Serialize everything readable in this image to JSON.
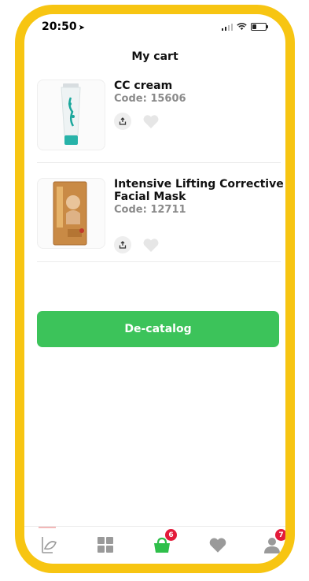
{
  "status_bar": {
    "time": "20:50"
  },
  "header": {
    "title": "My cart"
  },
  "cart": {
    "items": [
      {
        "name": "CC cream",
        "code": "Code: 15606"
      },
      {
        "name": "Intensive Lifting Corrective Facial Mask",
        "code": "Code: 12711"
      }
    ]
  },
  "actions": {
    "primary_label": "De-catalog"
  },
  "tabbar": {
    "tabs": [
      {
        "icon": "logo-icon"
      },
      {
        "icon": "grid-icon"
      },
      {
        "icon": "cart-icon",
        "badge": "6"
      },
      {
        "icon": "heart-icon"
      },
      {
        "icon": "profile-icon",
        "badge": "7"
      }
    ]
  },
  "colors": {
    "accent": "#3cc35a",
    "frame": "#f7c512",
    "badge": "#e31b3a"
  }
}
